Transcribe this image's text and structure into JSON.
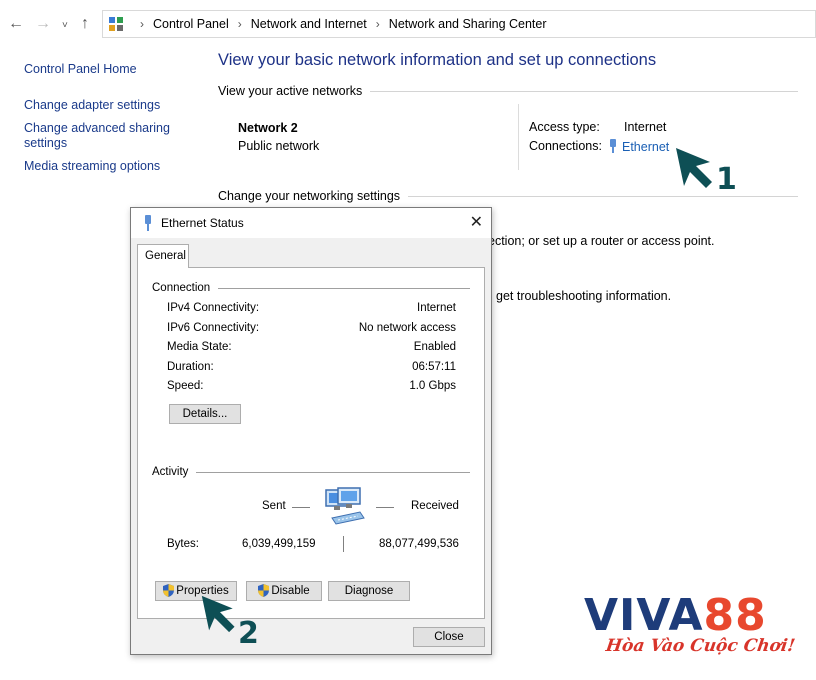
{
  "addressbar": {
    "breadcrumbs": [
      "Control Panel",
      "Network and Internet",
      "Network and Sharing Center"
    ]
  },
  "leftpane": {
    "items": [
      {
        "label": "Control Panel Home"
      },
      {
        "label": "Change adapter settings"
      },
      {
        "label": "Change advanced sharing settings"
      },
      {
        "label": "Media streaming options"
      }
    ]
  },
  "main": {
    "title": "View your basic network information and set up connections",
    "active_networks_label": "View your active networks",
    "network_name": "Network 2",
    "network_category": "Public network",
    "access_type_label": "Access type:",
    "access_type_value": "Internet",
    "connections_label": "Connections:",
    "connections_value": "Ethernet",
    "change_settings_label": "Change your networking settings",
    "partial_text_1": "ection; or set up a router or access point.",
    "partial_text_2": "get troubleshooting information."
  },
  "dialog": {
    "title": "Ethernet Status",
    "tab_general": "General",
    "connection_group": "Connection",
    "rows": [
      {
        "key": "IPv4 Connectivity:",
        "value": "Internet"
      },
      {
        "key": "IPv6 Connectivity:",
        "value": "No network access"
      },
      {
        "key": "Media State:",
        "value": "Enabled"
      },
      {
        "key": "Duration:",
        "value": "06:57:11"
      },
      {
        "key": "Speed:",
        "value": "1.0 Gbps"
      }
    ],
    "details_button": "Details...",
    "activity_group": "Activity",
    "sent_label": "Sent",
    "received_label": "Received",
    "bytes_label": "Bytes:",
    "bytes_sent": "6,039,499,159",
    "bytes_received": "88,077,499,536",
    "properties_button": "Properties",
    "disable_button": "Disable",
    "diagnose_button": "Diagnose",
    "close_button": "Close"
  },
  "annotations": {
    "step1": "1",
    "step2": "2"
  },
  "watermark": {
    "brand_part1": "VIVA",
    "brand_part2": "88",
    "tagline": "Hòa Vào Cuộc Chơi!"
  },
  "colors": {
    "link": "#1a3a8a",
    "title": "#1e3287",
    "arrow": "#0e4f55",
    "brand_blue": "#1e3c7a",
    "brand_red": "#e8482e"
  },
  "icons": [
    "back-arrow-icon",
    "forward-arrow-icon",
    "recent-dropdown-icon",
    "up-arrow-icon",
    "control-panel-icon",
    "ethernet-icon",
    "close-icon",
    "uac-shield-icon",
    "network-computers-icon",
    "pointer-arrow-icon"
  ]
}
